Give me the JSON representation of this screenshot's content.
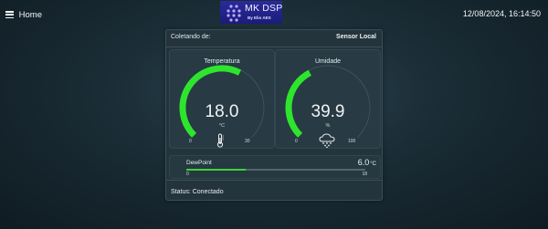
{
  "topbar": {
    "menu_label": "Home",
    "logo_title": "MK DSP",
    "logo_subtitle": "By Elio AES",
    "datetime": "12/08/2024, 16:14:50"
  },
  "card": {
    "collect_label": "Coletando de:",
    "sensor_name": "Sensor Local",
    "temperature": {
      "title": "Temperatura",
      "value": "18.0",
      "unit": "°C",
      "min": "0",
      "max": "30",
      "level": 0.6,
      "icon": "thermometer-icon",
      "color": "#2ee52e"
    },
    "humidity": {
      "title": "Umidade",
      "value": "39.9",
      "unit": "%",
      "min": "0",
      "max": "100",
      "level": 0.399,
      "icon": "rain-cloud-icon",
      "color": "#2ee52e"
    },
    "dewpoint": {
      "label": "DewPoint",
      "value": "6.0",
      "unit": "°C",
      "min": "0",
      "max": "18",
      "level": 0.333
    },
    "status": "Status: Conectado"
  }
}
